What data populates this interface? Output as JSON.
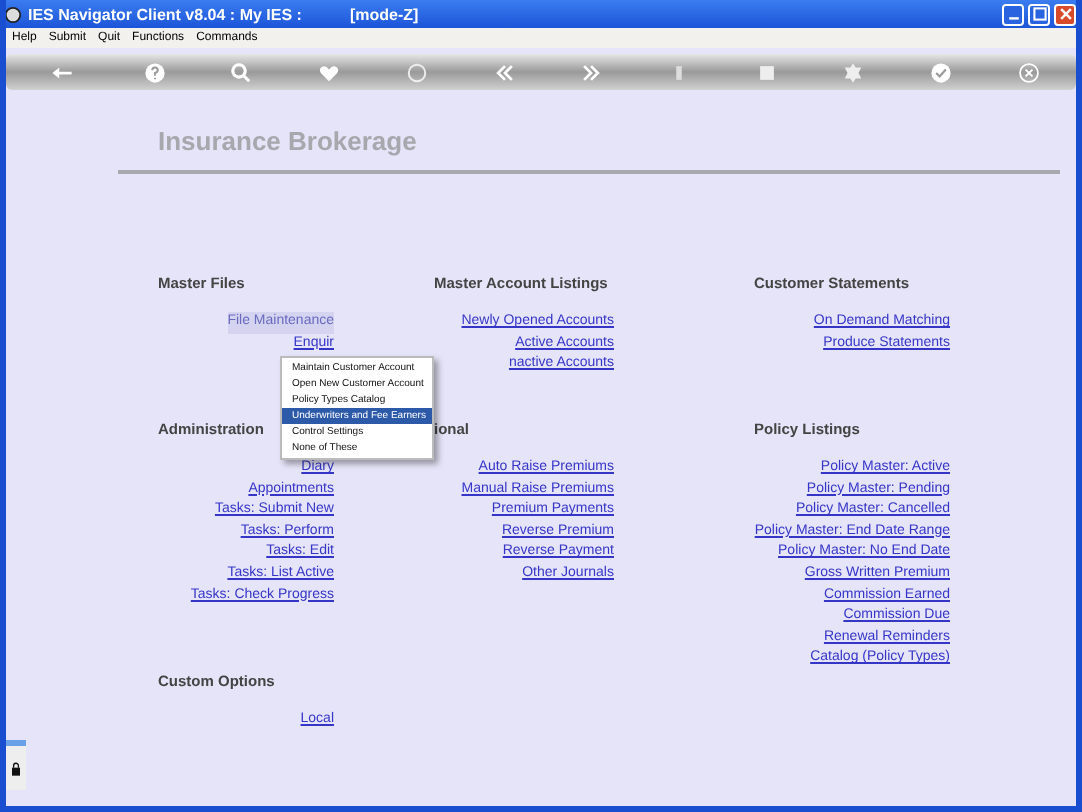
{
  "window": {
    "title": "IES Navigator Client v8.04 : My IES :",
    "mode": "[mode-Z]"
  },
  "menu": [
    "Help",
    "Submit",
    "Quit",
    "Functions",
    "Commands"
  ],
  "page_title": "Insurance Brokerage",
  "sections": [
    {
      "heading": "Master Files",
      "links": [
        {
          "label": "File Maintenance",
          "selected": true
        },
        {
          "label": "Enquir",
          "selected": false
        }
      ]
    },
    {
      "heading": "Master Account Listings",
      "links": [
        {
          "label": "Newly Opened Accounts",
          "selected": false
        },
        {
          "label": "Active Accounts",
          "selected": false
        },
        {
          "label": "nactive Accounts",
          "selected": false
        }
      ]
    },
    {
      "heading": "Customer Statements",
      "links": [
        {
          "label": "On Demand Matching",
          "selected": false
        },
        {
          "label": "Produce Statements",
          "selected": false
        }
      ]
    },
    {
      "heading": "Administration",
      "links": [
        {
          "label": "Diary",
          "selected": false
        },
        {
          "label": "Appointments",
          "selected": false
        },
        {
          "label": "Tasks: Submit New",
          "selected": false
        },
        {
          "label": "Tasks: Perform",
          "selected": false
        },
        {
          "label": "Tasks: Edit",
          "selected": false
        },
        {
          "label": "Tasks: List Active",
          "selected": false
        },
        {
          "label": "Tasks: Check Progress",
          "selected": false
        }
      ]
    },
    {
      "heading": "ional",
      "links": [
        {
          "label": "Auto Raise Premiums",
          "selected": false
        },
        {
          "label": "Manual Raise Premiums",
          "selected": false
        },
        {
          "label": "Premium Payments",
          "selected": false
        },
        {
          "label": "Reverse Premium",
          "selected": false
        },
        {
          "label": "Reverse Payment",
          "selected": false
        },
        {
          "label": "Other Journals",
          "selected": false
        }
      ]
    },
    {
      "heading": "Policy Listings",
      "links": [
        {
          "label": "Policy Master: Active",
          "selected": false
        },
        {
          "label": "Policy Master: Pending",
          "selected": false
        },
        {
          "label": "Policy Master: Cancelled",
          "selected": false
        },
        {
          "label": "Policy Master: End Date Range",
          "selected": false
        },
        {
          "label": "Policy Master: No End Date",
          "selected": false
        },
        {
          "label": "Gross Written Premium",
          "selected": false
        },
        {
          "label": "Commission Earned",
          "selected": false
        },
        {
          "label": "Commission Due",
          "selected": false
        },
        {
          "label": "Renewal Reminders",
          "selected": false
        },
        {
          "label": "Catalog (Policy Types)",
          "selected": false
        }
      ]
    },
    {
      "heading": "Custom Options",
      "links": [
        {
          "label": "Local",
          "selected": false
        }
      ]
    }
  ],
  "context_menu": [
    {
      "label": "Maintain Customer Account",
      "selected": false
    },
    {
      "label": "Open New Customer Account",
      "selected": false
    },
    {
      "label": "Policy Types Catalog",
      "selected": false
    },
    {
      "label": "Underwriters and Fee Earners",
      "selected": true
    },
    {
      "label": "Control Settings",
      "selected": false
    },
    {
      "label": "None of These",
      "selected": false
    }
  ]
}
